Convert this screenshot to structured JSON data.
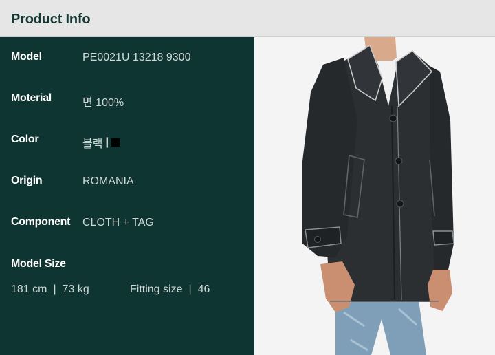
{
  "header": {
    "title": "Product Info"
  },
  "info": {
    "model_label": "Model",
    "model_value": "PE0021U 13218 9300",
    "material_label": "Moterial",
    "material_value": "면 100%",
    "color_label": "Color",
    "color_value": "블랙",
    "color_separator": "|",
    "color_swatch": "#000000",
    "origin_label": "Origin",
    "origin_value": "ROMANIA",
    "component_label": "Component",
    "component_value": "CLOTH + TAG"
  },
  "model_size": {
    "title": "Model Size",
    "height": "181 cm",
    "weight": "73 kg",
    "separator": "|",
    "fitting_label": "Fitting size",
    "fitting_value": "46"
  },
  "colors": {
    "header_bg": "#e6e6e6",
    "panel_bg": "#0f3533",
    "title_text": "#163834"
  }
}
